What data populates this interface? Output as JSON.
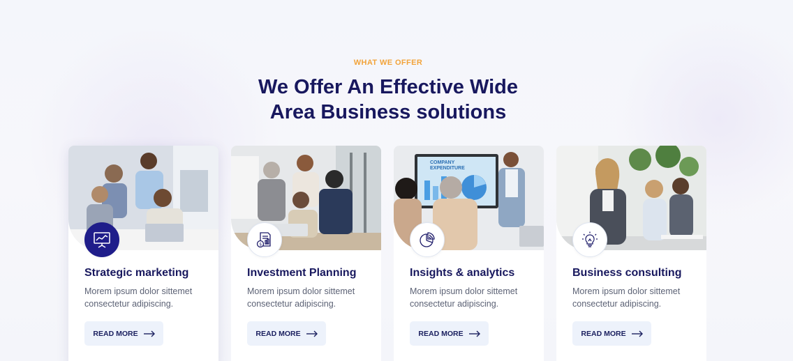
{
  "section": {
    "eyebrow": "WHAT WE OFFER",
    "heading_line1": "We Offer An Effective Wide",
    "heading_line2": "Area Business solutions"
  },
  "cards": [
    {
      "title": "Strategic marketing",
      "desc_line1": "Morem ipsum dolor sittemet",
      "desc_line2": "consectetur adipiscing.",
      "button": "READ MORE",
      "icon": "presentation-chart-icon",
      "active": true
    },
    {
      "title": "Investment Planning",
      "desc_line1": "Morem ipsum dolor sittemet",
      "desc_line2": "consectetur adipiscing.",
      "button": "READ MORE",
      "icon": "investment-document-icon",
      "active": false
    },
    {
      "title": "Insights & analytics",
      "desc_line1": "Morem ipsum dolor sittemet",
      "desc_line2": "consectetur adipiscing.",
      "button": "READ MORE",
      "icon": "pie-chart-icon",
      "active": false
    },
    {
      "title": "Business consulting",
      "desc_line1": "Morem ipsum dolor sittemet",
      "desc_line2": "consectetur adipiscing.",
      "button": "READ MORE",
      "icon": "lightbulb-icon",
      "active": false
    }
  ],
  "images": {
    "card3_screen_line1": "COMPANY",
    "card3_screen_line2": "EXPENDITURE"
  },
  "colors": {
    "eyebrow": "#f2a33a",
    "heading": "#18185e",
    "accent": "#1f1d8a",
    "button_bg": "#edf2fb"
  }
}
